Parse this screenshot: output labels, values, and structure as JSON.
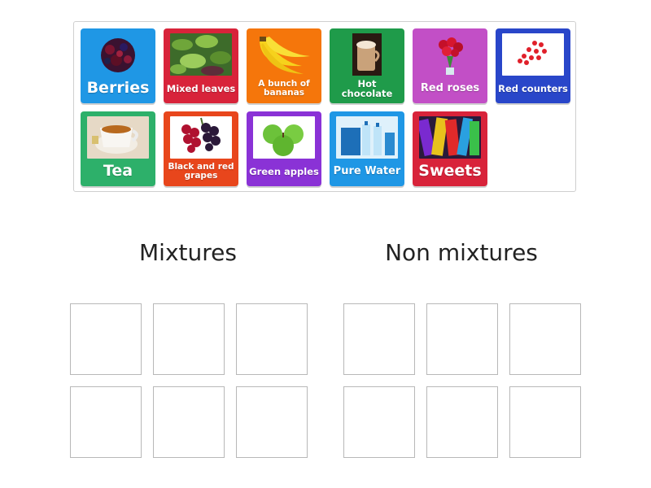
{
  "cards": [
    {
      "label": "Berries",
      "color": "#1f97e5",
      "icon": "berries-image"
    },
    {
      "label": "Mixed leaves",
      "color": "#d8233a",
      "icon": "mixed-leaves-image"
    },
    {
      "label": "A bunch of bananas",
      "color": "#f5760b",
      "icon": "bananas-image"
    },
    {
      "label": "Hot chocolate",
      "color": "#1f9b4a",
      "icon": "hot-chocolate-image"
    },
    {
      "label": "Red roses",
      "color": "#c24fc6",
      "icon": "red-roses-image"
    },
    {
      "label": "Red counters",
      "color": "#2946c9",
      "icon": "red-counters-image"
    },
    {
      "label": "Tea",
      "color": "#2db06a",
      "icon": "tea-image"
    },
    {
      "label": "Black and red grapes",
      "color": "#e8461c",
      "icon": "grapes-image"
    },
    {
      "label": "Green apples",
      "color": "#8a32d6",
      "icon": "green-apples-image"
    },
    {
      "label": "Pure Water",
      "color": "#1f97e5",
      "icon": "water-bottles-image"
    },
    {
      "label": "Sweets",
      "color": "#d8233a",
      "icon": "sweets-image"
    }
  ],
  "groups": [
    {
      "title": "Mixtures"
    },
    {
      "title": "Non mixtures"
    }
  ]
}
